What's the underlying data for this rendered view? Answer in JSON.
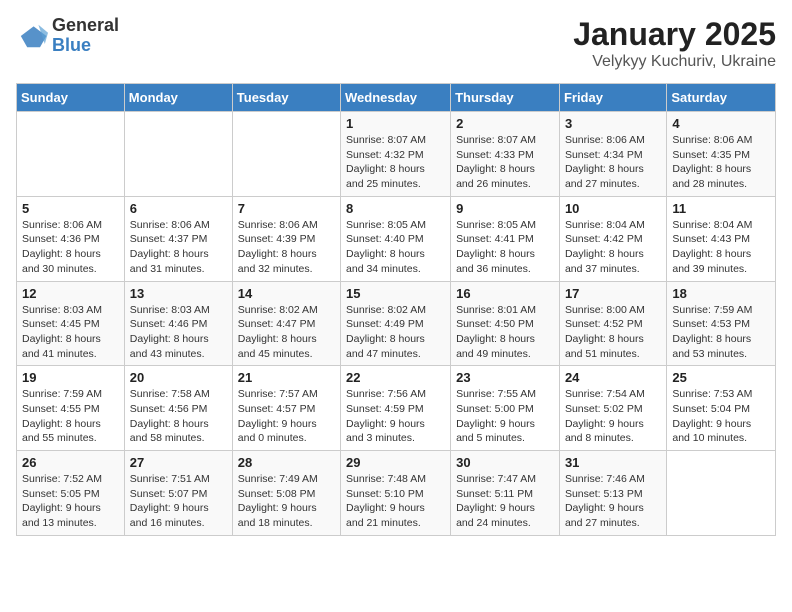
{
  "logo": {
    "general": "General",
    "blue": "Blue"
  },
  "title": "January 2025",
  "subtitle": "Velykyy Kuchuriv, Ukraine",
  "days_of_week": [
    "Sunday",
    "Monday",
    "Tuesday",
    "Wednesday",
    "Thursday",
    "Friday",
    "Saturday"
  ],
  "weeks": [
    [
      {
        "num": "",
        "info": ""
      },
      {
        "num": "",
        "info": ""
      },
      {
        "num": "",
        "info": ""
      },
      {
        "num": "1",
        "info": "Sunrise: 8:07 AM\nSunset: 4:32 PM\nDaylight: 8 hours and 25 minutes."
      },
      {
        "num": "2",
        "info": "Sunrise: 8:07 AM\nSunset: 4:33 PM\nDaylight: 8 hours and 26 minutes."
      },
      {
        "num": "3",
        "info": "Sunrise: 8:06 AM\nSunset: 4:34 PM\nDaylight: 8 hours and 27 minutes."
      },
      {
        "num": "4",
        "info": "Sunrise: 8:06 AM\nSunset: 4:35 PM\nDaylight: 8 hours and 28 minutes."
      }
    ],
    [
      {
        "num": "5",
        "info": "Sunrise: 8:06 AM\nSunset: 4:36 PM\nDaylight: 8 hours and 30 minutes."
      },
      {
        "num": "6",
        "info": "Sunrise: 8:06 AM\nSunset: 4:37 PM\nDaylight: 8 hours and 31 minutes."
      },
      {
        "num": "7",
        "info": "Sunrise: 8:06 AM\nSunset: 4:39 PM\nDaylight: 8 hours and 32 minutes."
      },
      {
        "num": "8",
        "info": "Sunrise: 8:05 AM\nSunset: 4:40 PM\nDaylight: 8 hours and 34 minutes."
      },
      {
        "num": "9",
        "info": "Sunrise: 8:05 AM\nSunset: 4:41 PM\nDaylight: 8 hours and 36 minutes."
      },
      {
        "num": "10",
        "info": "Sunrise: 8:04 AM\nSunset: 4:42 PM\nDaylight: 8 hours and 37 minutes."
      },
      {
        "num": "11",
        "info": "Sunrise: 8:04 AM\nSunset: 4:43 PM\nDaylight: 8 hours and 39 minutes."
      }
    ],
    [
      {
        "num": "12",
        "info": "Sunrise: 8:03 AM\nSunset: 4:45 PM\nDaylight: 8 hours and 41 minutes."
      },
      {
        "num": "13",
        "info": "Sunrise: 8:03 AM\nSunset: 4:46 PM\nDaylight: 8 hours and 43 minutes."
      },
      {
        "num": "14",
        "info": "Sunrise: 8:02 AM\nSunset: 4:47 PM\nDaylight: 8 hours and 45 minutes."
      },
      {
        "num": "15",
        "info": "Sunrise: 8:02 AM\nSunset: 4:49 PM\nDaylight: 8 hours and 47 minutes."
      },
      {
        "num": "16",
        "info": "Sunrise: 8:01 AM\nSunset: 4:50 PM\nDaylight: 8 hours and 49 minutes."
      },
      {
        "num": "17",
        "info": "Sunrise: 8:00 AM\nSunset: 4:52 PM\nDaylight: 8 hours and 51 minutes."
      },
      {
        "num": "18",
        "info": "Sunrise: 7:59 AM\nSunset: 4:53 PM\nDaylight: 8 hours and 53 minutes."
      }
    ],
    [
      {
        "num": "19",
        "info": "Sunrise: 7:59 AM\nSunset: 4:55 PM\nDaylight: 8 hours and 55 minutes."
      },
      {
        "num": "20",
        "info": "Sunrise: 7:58 AM\nSunset: 4:56 PM\nDaylight: 8 hours and 58 minutes."
      },
      {
        "num": "21",
        "info": "Sunrise: 7:57 AM\nSunset: 4:57 PM\nDaylight: 9 hours and 0 minutes."
      },
      {
        "num": "22",
        "info": "Sunrise: 7:56 AM\nSunset: 4:59 PM\nDaylight: 9 hours and 3 minutes."
      },
      {
        "num": "23",
        "info": "Sunrise: 7:55 AM\nSunset: 5:00 PM\nDaylight: 9 hours and 5 minutes."
      },
      {
        "num": "24",
        "info": "Sunrise: 7:54 AM\nSunset: 5:02 PM\nDaylight: 9 hours and 8 minutes."
      },
      {
        "num": "25",
        "info": "Sunrise: 7:53 AM\nSunset: 5:04 PM\nDaylight: 9 hours and 10 minutes."
      }
    ],
    [
      {
        "num": "26",
        "info": "Sunrise: 7:52 AM\nSunset: 5:05 PM\nDaylight: 9 hours and 13 minutes."
      },
      {
        "num": "27",
        "info": "Sunrise: 7:51 AM\nSunset: 5:07 PM\nDaylight: 9 hours and 16 minutes."
      },
      {
        "num": "28",
        "info": "Sunrise: 7:49 AM\nSunset: 5:08 PM\nDaylight: 9 hours and 18 minutes."
      },
      {
        "num": "29",
        "info": "Sunrise: 7:48 AM\nSunset: 5:10 PM\nDaylight: 9 hours and 21 minutes."
      },
      {
        "num": "30",
        "info": "Sunrise: 7:47 AM\nSunset: 5:11 PM\nDaylight: 9 hours and 24 minutes."
      },
      {
        "num": "31",
        "info": "Sunrise: 7:46 AM\nSunset: 5:13 PM\nDaylight: 9 hours and 27 minutes."
      },
      {
        "num": "",
        "info": ""
      }
    ]
  ]
}
